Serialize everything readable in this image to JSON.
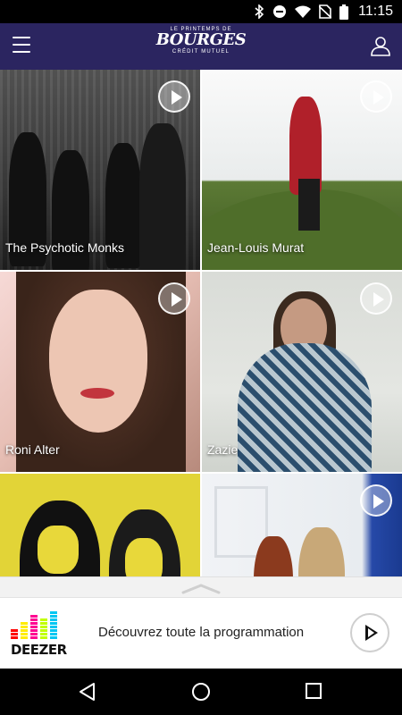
{
  "status": {
    "time": "11:15",
    "icons": [
      "bluetooth-icon",
      "do-not-disturb-icon",
      "wifi-icon",
      "no-sim-icon",
      "battery-icon"
    ]
  },
  "appbar": {
    "logo": {
      "top": "LE PRINTEMPS DE",
      "main": "BOURGES",
      "bottom": "CRÉDIT MUTUEL"
    },
    "icons": [
      "menu-icon",
      "profile-icon"
    ]
  },
  "artists": [
    {
      "name": "The Psychotic Monks"
    },
    {
      "name": "Jean-Louis Murat"
    },
    {
      "name": "Roni Alter"
    },
    {
      "name": "Zazie"
    },
    {
      "name": ""
    },
    {
      "name": ""
    }
  ],
  "promo": {
    "brand": "DEEZER",
    "label": "Découvrez toute la programmation"
  },
  "colors": {
    "appbar": "#2b2560",
    "deezer_bars": [
      "#ff0000",
      "#ffed00",
      "#ff0092",
      "#c2ff00",
      "#00c7f2",
      "#ffb400"
    ]
  }
}
